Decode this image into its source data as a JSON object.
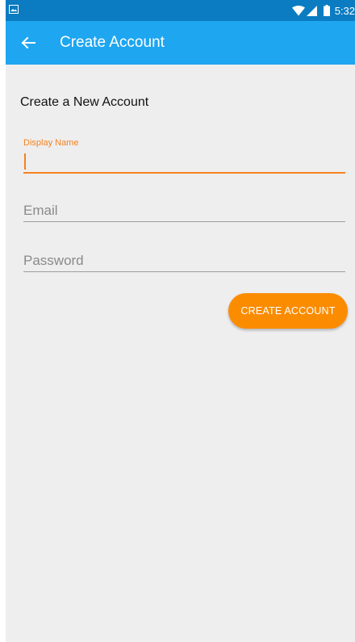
{
  "status_bar": {
    "time": "5:32",
    "icons": [
      "image-notification-icon",
      "wifi-icon",
      "signal-icon",
      "battery-icon"
    ]
  },
  "app_bar": {
    "title": "Create Account",
    "back_icon": "back-arrow-icon"
  },
  "form": {
    "heading": "Create a New Account",
    "display_name": {
      "label": "Display Name",
      "value": ""
    },
    "email": {
      "placeholder": "Email",
      "value": ""
    },
    "password": {
      "placeholder": "Password",
      "value": ""
    },
    "submit_label": "CREATE ACCOUNT"
  },
  "colors": {
    "status_bar": "#0b7cc1",
    "app_bar": "#1ea6f0",
    "accent": "#f5821f",
    "button": "#fb8c00",
    "background": "#eeeeee",
    "underline_inactive": "#9e9e9e"
  }
}
